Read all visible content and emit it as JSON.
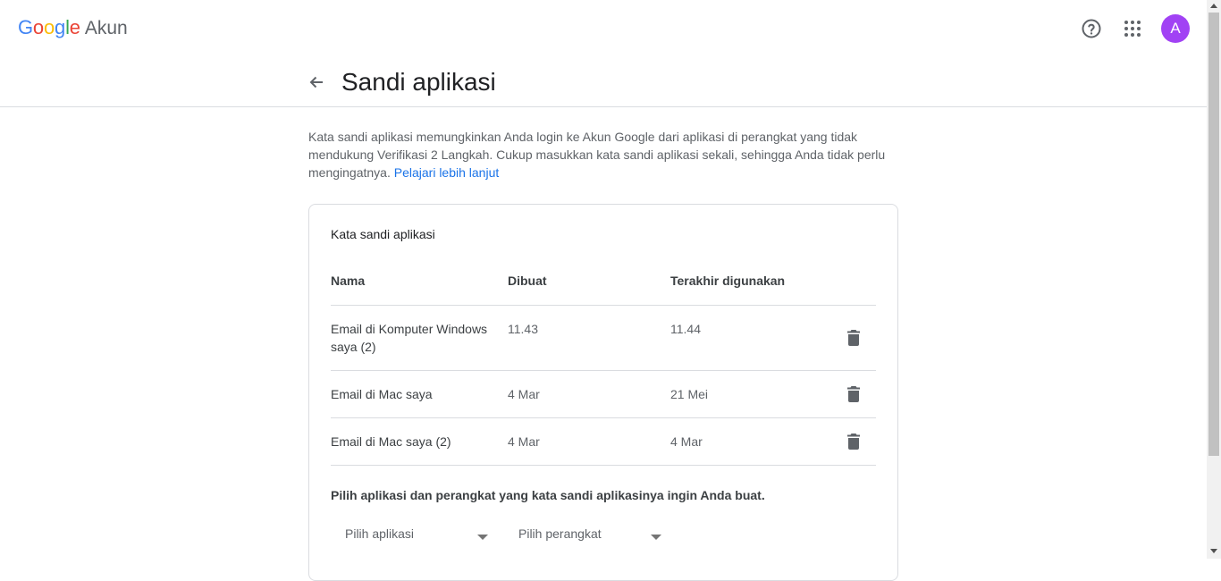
{
  "header": {
    "logo": {
      "letters": [
        {
          "ch": "G",
          "color": "#4285f4"
        },
        {
          "ch": "o",
          "color": "#ea4335"
        },
        {
          "ch": "o",
          "color": "#fbbc05"
        },
        {
          "ch": "g",
          "color": "#4285f4"
        },
        {
          "ch": "l",
          "color": "#34a853"
        },
        {
          "ch": "e",
          "color": "#ea4335"
        }
      ],
      "product": "Akun"
    },
    "help_icon": "help-circle-icon",
    "apps_icon": "apps-grid-icon",
    "avatar_initial": "A",
    "avatar_color": "#a142f4"
  },
  "page": {
    "title": "Sandi aplikasi",
    "back_icon": "arrow-back-icon"
  },
  "description": {
    "text": "Kata sandi aplikasi memungkinkan Anda login ke Akun Google dari aplikasi di perangkat yang tidak mendukung Verifikasi 2 Langkah. Cukup masukkan kata sandi aplikasi sekali, sehingga Anda tidak perlu mengingatnya.",
    "link": "Pelajari lebih lanjut",
    "link_color": "#1a73e8"
  },
  "card": {
    "title": "Kata sandi aplikasi",
    "columns": {
      "name": "Nama",
      "created": "Dibuat",
      "last_used": "Terakhir digunakan"
    },
    "rows": [
      {
        "name": "Email di Komputer Windows saya (2)",
        "created": "11.43",
        "last_used": "11.44"
      },
      {
        "name": "Email di Mac saya",
        "created": "4 Mar",
        "last_used": "21 Mei"
      },
      {
        "name": "Email di Mac saya (2)",
        "created": "4 Mar",
        "last_used": "4 Mar"
      }
    ],
    "delete_icon": "trash-icon",
    "generate_label": "Pilih aplikasi dan perangkat yang kata sandi aplikasinya ingin Anda buat.",
    "select_app": "Pilih aplikasi",
    "select_device": "Pilih perangkat"
  }
}
